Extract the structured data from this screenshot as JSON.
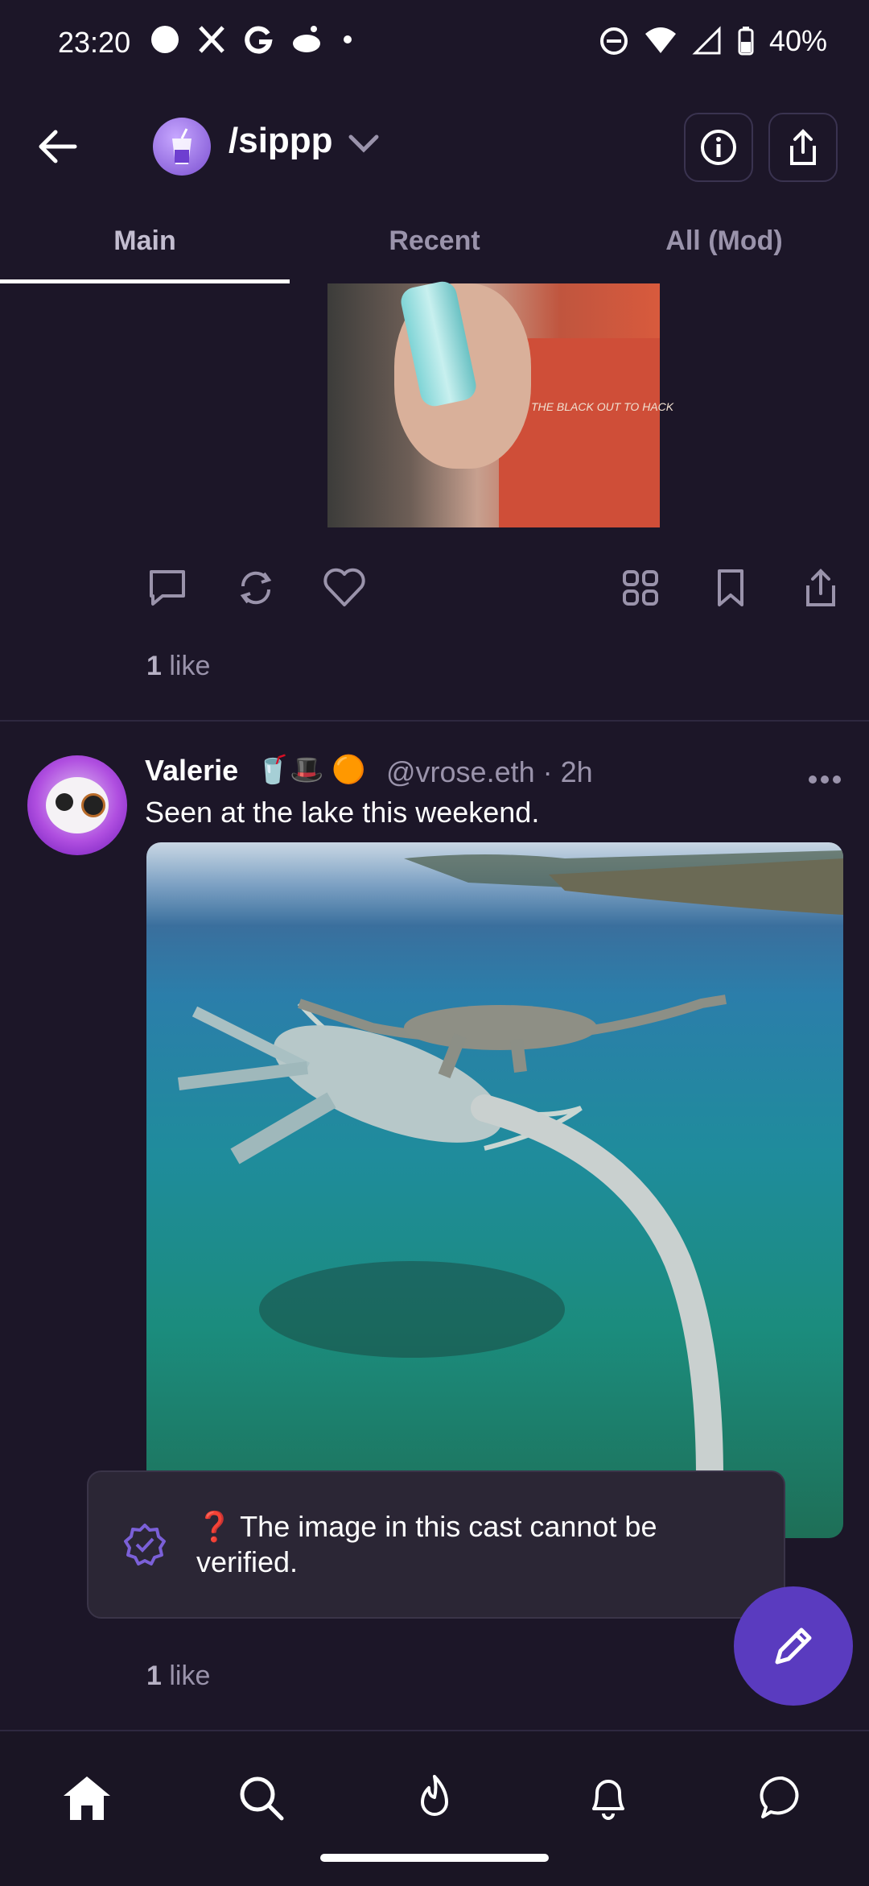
{
  "status_bar": {
    "time": "23:20",
    "battery": "40%",
    "left_icons": [
      "circle-dot-icon",
      "x-icon",
      "g-icon",
      "reddit-icon",
      "dot-icon"
    ],
    "right_icons": [
      "dnd-icon",
      "wifi-icon",
      "signal-icon",
      "battery-icon"
    ]
  },
  "header": {
    "channel_name": "/sippp",
    "icons": [
      "back-arrow-icon",
      "chevron-down-icon",
      "info-icon",
      "share-icon"
    ]
  },
  "tabs": [
    {
      "label": "Main",
      "active": true
    },
    {
      "label": "Recent",
      "active": false
    },
    {
      "label": "All (Mod)",
      "active": false
    }
  ],
  "post1": {
    "image_text": "THE BLACK OUT TO HACK",
    "like_number": "1",
    "like_word": "like"
  },
  "post2": {
    "author": "Valerie",
    "author_emoji": "🥤🎩 🟠",
    "handle_time": "@vrose.eth · 2h",
    "text": "Seen at the lake this weekend.",
    "like_number": "1",
    "like_word": "like"
  },
  "toast": {
    "text": "❓ The image in this cast cannot be verified."
  },
  "bottom_nav": [
    "home-icon",
    "search-icon",
    "flame-icon",
    "bell-icon",
    "chat-icon"
  ],
  "colors": {
    "background": "#1c1628",
    "accent": "#5a3bbf",
    "muted_text": "#9a93ab",
    "toast_bg": "#2b2635"
  }
}
